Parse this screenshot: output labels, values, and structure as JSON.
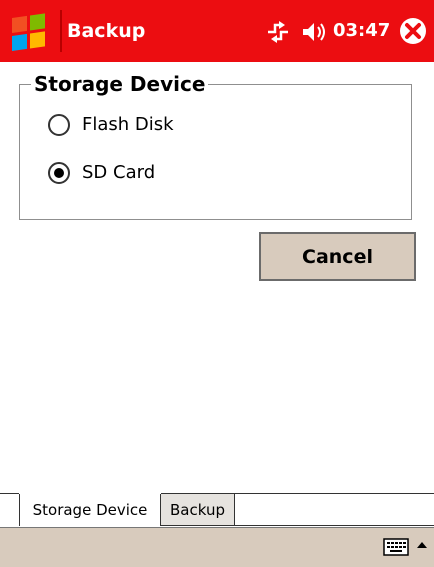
{
  "titlebar": {
    "app_title": "Backup",
    "clock": "03:47",
    "bg_color": "#ec0d11"
  },
  "icons": {
    "start": "windows-flag-icon",
    "connectivity": "connectivity-icon",
    "volume": "speaker-icon",
    "close": "close-icon",
    "keyboard": "keyboard-icon",
    "sip": "up-arrow-icon"
  },
  "storage": {
    "group_title": "Storage Device",
    "options": [
      {
        "label": "Flash Disk",
        "selected": false
      },
      {
        "label": "SD Card",
        "selected": true
      }
    ]
  },
  "buttons": {
    "cancel": "Cancel"
  },
  "tabs": [
    {
      "label": "Storage Device",
      "active": true
    },
    {
      "label": "Backup",
      "active": false
    }
  ]
}
